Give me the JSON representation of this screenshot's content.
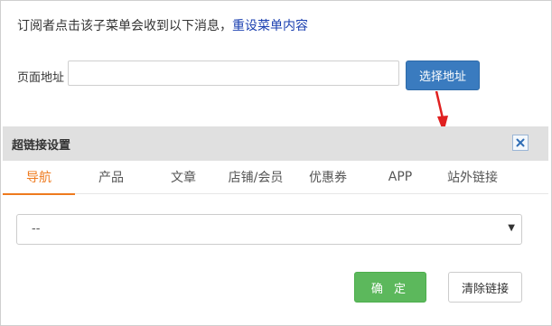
{
  "notice": {
    "text": "订阅者点击该子菜单会收到以下消息，",
    "reset_link": "重设菜单内容"
  },
  "address": {
    "label": "页面地址",
    "value": "",
    "placeholder": "",
    "choose_button": "选择地址"
  },
  "dialog": {
    "title": "超链接设置",
    "close_icon": "close-icon",
    "tabs": [
      {
        "label": "导航",
        "active": true
      },
      {
        "label": "产品",
        "active": false
      },
      {
        "label": "文章",
        "active": false
      },
      {
        "label": "店铺/会员",
        "active": false
      },
      {
        "label": "优惠券",
        "active": false
      },
      {
        "label": "APP",
        "active": false
      },
      {
        "label": "站外链接",
        "active": false
      }
    ],
    "select": {
      "value": "--"
    },
    "confirm_button": "确 定",
    "clear_button": "清除链接"
  },
  "colors": {
    "accent_tab": "#ee7a1e",
    "primary_button": "#3a7bbf",
    "confirm_button": "#5cb85c",
    "link": "#1a3fb0",
    "annotation_arrow": "#e02020"
  }
}
